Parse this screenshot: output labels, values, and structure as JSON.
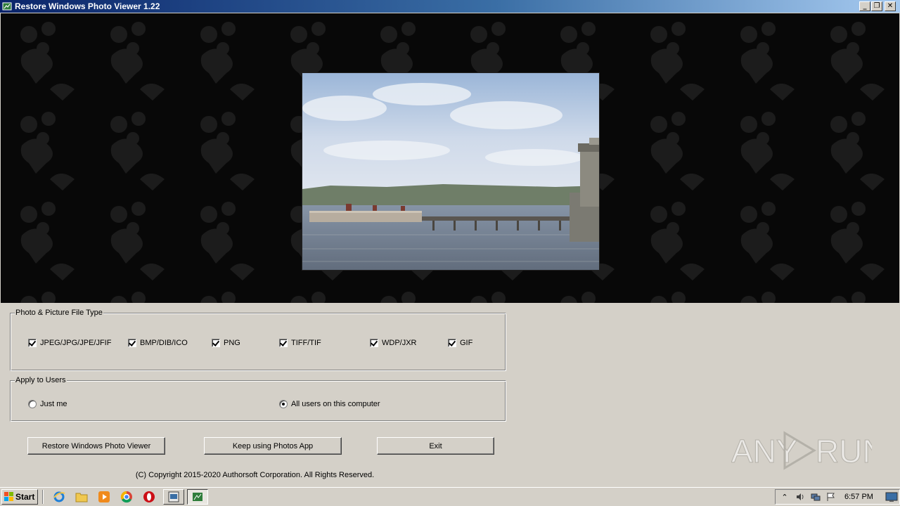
{
  "window": {
    "title": "Restore Windows Photo Viewer 1.22",
    "minimize_glyph": "_",
    "restore_glyph": "❐",
    "close_glyph": "✕"
  },
  "file_types": {
    "legend": "Photo & Picture File Type",
    "items": [
      {
        "label": "JPEG/JPG/JPE/JFIF",
        "checked": true
      },
      {
        "label": "BMP/DIB/ICO",
        "checked": true
      },
      {
        "label": "PNG",
        "checked": true
      },
      {
        "label": "TIFF/TIF",
        "checked": true
      },
      {
        "label": "WDP/JXR",
        "checked": true
      },
      {
        "label": "GIF",
        "checked": true
      }
    ]
  },
  "apply_users": {
    "legend": "Apply to Users",
    "options": [
      {
        "label": "Just me",
        "selected": false
      },
      {
        "label": "All users on this computer",
        "selected": true
      }
    ]
  },
  "buttons": {
    "restore": "Restore Windows Photo Viewer",
    "keep": "Keep using Photos App",
    "exit": "Exit"
  },
  "copyright": "(C) Copyright 2015-2020 Authorsoft Corporation. All Rights Reserved.",
  "watermark": "ANY RUN",
  "taskbar": {
    "start_label": "Start",
    "pinned_icons": [
      "internet-explorer-icon",
      "folder-icon",
      "media-player-icon",
      "chrome-icon",
      "opera-icon"
    ],
    "clock": "6:57 PM"
  },
  "colors": {
    "titlebar_start": "#0a246a",
    "titlebar_end": "#a6caf0",
    "face": "#d4d0c8",
    "viewer_bg": "#080808"
  }
}
